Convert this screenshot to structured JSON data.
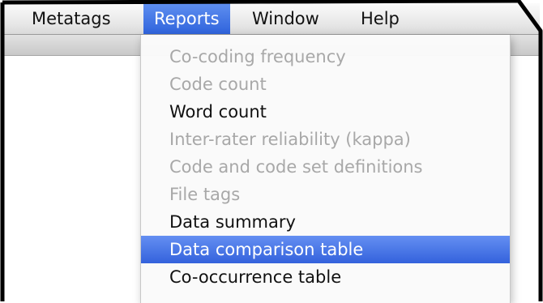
{
  "menubar": {
    "items": [
      {
        "label": "Metatags"
      },
      {
        "label": "Reports"
      },
      {
        "label": "Window"
      },
      {
        "label": "Help"
      }
    ],
    "selected_index": 1,
    "selected_color": "#3a6fe0"
  },
  "reports_menu": {
    "items": [
      {
        "label": "Co-coding frequency",
        "enabled": false
      },
      {
        "label": "Code count",
        "enabled": false
      },
      {
        "label": "Word count",
        "enabled": true
      },
      {
        "label": "Inter-rater reliability (kappa)",
        "enabled": false
      },
      {
        "label": "Code and code set definitions",
        "enabled": false
      },
      {
        "label": "File tags",
        "enabled": false
      },
      {
        "label": "Data summary",
        "enabled": true
      },
      {
        "label": "Data comparison table",
        "enabled": true,
        "highlighted": true
      },
      {
        "label": "Co-occurrence table",
        "enabled": true
      }
    ],
    "disabled_color": "#a8a8a8",
    "highlight_color": "#3a6fe0"
  }
}
